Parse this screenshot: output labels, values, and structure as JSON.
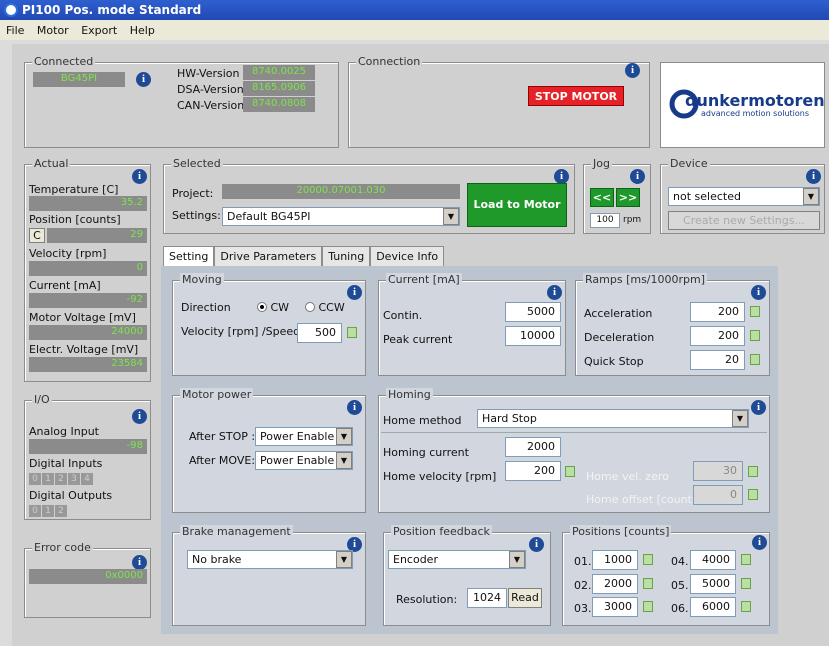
{
  "window": {
    "title": "PI100 Pos. mode Standard"
  },
  "menu": [
    "File",
    "Motor",
    "Export",
    "Help"
  ],
  "connected": {
    "title": "Connected",
    "device": "BG45PI",
    "hw_label": "HW-Version",
    "hw_value": "8740.0025",
    "dsa_label": "DSA-Version",
    "dsa_value": "8165.0906",
    "can_label": "CAN-Version",
    "can_value": "8740.0808"
  },
  "connection": {
    "title": "Connection",
    "stop_button": "STOP MOTOR"
  },
  "logo": {
    "name": "dunkermotoren",
    "tagline": "advanced motion solutions"
  },
  "actual": {
    "title": "Actual",
    "temperature_label": "Temperature [C]",
    "temperature": "35.2",
    "position_label": "Position [counts]",
    "position_button": "C",
    "position": "29",
    "velocity_label": "Velocity [rpm]",
    "velocity": "0",
    "current_label": "Current [mA]",
    "current": "-92",
    "motor_voltage_label": "Motor Voltage [mV]",
    "motor_voltage": "24000",
    "electr_voltage_label": "Electr. Voltage [mV]",
    "electr_voltage": "23584"
  },
  "selected": {
    "title": "Selected",
    "project_label": "Project:",
    "project": "20000.07001.030",
    "settings_label": "Settings:",
    "settings_value": "Default BG45PI",
    "load_button": "Load to Motor"
  },
  "jog": {
    "title": "Jog",
    "left": "<<",
    "right": ">>",
    "speed": "100",
    "unit": "rpm"
  },
  "device": {
    "title": "Device",
    "select_value": "not selected",
    "create_button": "Create new Settings..."
  },
  "io": {
    "title": "I/O",
    "analog_label": "Analog Input",
    "analog_value": "-98",
    "digital_in_label": "Digital Inputs",
    "digital_inputs": [
      "0",
      "1",
      "2",
      "3",
      "4"
    ],
    "digital_out_label": "Digital Outputs",
    "digital_outputs": [
      "0",
      "1",
      "2"
    ]
  },
  "error": {
    "title": "Error code",
    "value": "0x0000"
  },
  "tabs": [
    "Setting",
    "Drive Parameters",
    "Tuning",
    "Device Info"
  ],
  "moving": {
    "title": "Moving",
    "direction_label": "Direction",
    "cw": "CW",
    "ccw": "CCW",
    "velocity_label": "Velocity [rpm] /Speed/",
    "velocity": "500"
  },
  "current": {
    "title": "Current [mA]",
    "contin_label": "Contin.",
    "contin": "5000",
    "peak_label": "Peak current",
    "peak": "10000"
  },
  "ramps": {
    "title": "Ramps [ms/1000rpm]",
    "accel_label": "Acceleration",
    "accel": "200",
    "decel_label": "Deceleration",
    "decel": "200",
    "quick_label": "Quick Stop",
    "quick": "20"
  },
  "motor_power": {
    "title": "Motor power",
    "after_stop_label": "After STOP :",
    "after_stop": "Power Enable",
    "after_move_label": "After MOVE:",
    "after_move": "Power Enable"
  },
  "homing": {
    "title": "Homing",
    "method_label": "Home method",
    "method": "Hard Stop",
    "current_label": "Homing current",
    "current": "2000",
    "velocity_label": "Home velocity [rpm]",
    "velocity": "200",
    "vel_zero_label": "Home vel. zero",
    "vel_zero": "30",
    "offset_label": "Home offset [counts]",
    "offset": "0"
  },
  "brake": {
    "title": "Brake management",
    "value": "No brake"
  },
  "feedback": {
    "title": "Position feedback",
    "value": "Encoder",
    "resolution_label": "Resolution:",
    "resolution": "1024",
    "read_button": "Read"
  },
  "positions": {
    "title": "Positions [counts]",
    "items": [
      {
        "label": "01.",
        "value": "1000"
      },
      {
        "label": "02.",
        "value": "2000"
      },
      {
        "label": "03.",
        "value": "3000"
      },
      {
        "label": "04.",
        "value": "4000"
      },
      {
        "label": "05.",
        "value": "5000"
      },
      {
        "label": "06.",
        "value": "6000"
      }
    ]
  }
}
